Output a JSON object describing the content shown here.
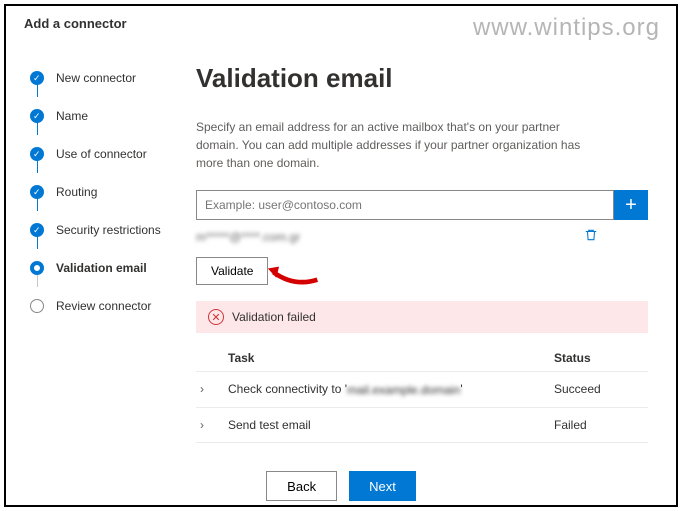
{
  "watermark": "www.wintips.org",
  "header_title": "Add a connector",
  "steps": [
    {
      "label": "New connector"
    },
    {
      "label": "Name"
    },
    {
      "label": "Use of connector"
    },
    {
      "label": "Routing"
    },
    {
      "label": "Security restrictions"
    },
    {
      "label": "Validation email"
    },
    {
      "label": "Review connector"
    }
  ],
  "page_title": "Validation email",
  "description": "Specify an email address for an active mailbox that's on your partner domain. You can add multiple addresses if your partner organization has more than one domain.",
  "email_input": {
    "placeholder": "Example: user@contoso.com"
  },
  "added_email": "m*****@****.com.gr",
  "validate_label": "Validate",
  "error_text": "Validation failed",
  "table": {
    "col_task": "Task",
    "col_status": "Status",
    "rows": [
      {
        "task_prefix": "Check connectivity to '",
        "task_blur": "mail.example.domain",
        "task_suffix": "'",
        "status": "Succeed"
      },
      {
        "task_prefix": "Send test email",
        "task_blur": "",
        "task_suffix": "",
        "status": "Failed"
      }
    ]
  },
  "footer": {
    "back": "Back",
    "next": "Next"
  }
}
